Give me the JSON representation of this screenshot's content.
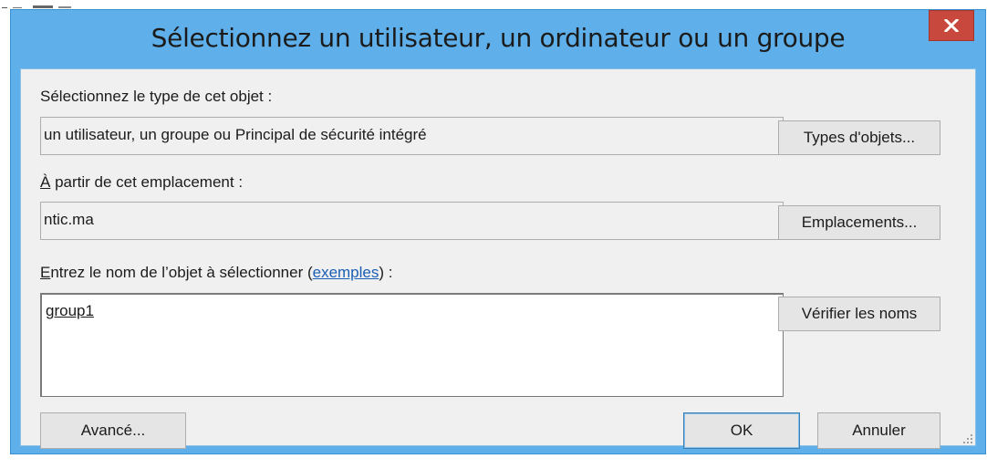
{
  "dialog": {
    "title": "Sélectionnez un utilisateur, un ordinateur ou un groupe",
    "close_icon": "close-icon"
  },
  "object_type": {
    "label": "Sélectionnez le type de cet objet :",
    "value": "un utilisateur, un groupe ou Principal de sécurité intégré",
    "button_label": "Types d'objets..."
  },
  "location": {
    "label_prefix": "À",
    "label_rest": " partir de cet emplacement :",
    "value": "ntic.ma",
    "button_label": "Emplacements..."
  },
  "object_name": {
    "label_accel": "E",
    "label_rest": "ntrez le nom de l’objet à sélectionner (",
    "link": "exemples",
    "label_end": ") :",
    "value": "group1",
    "check_button_label": "Vérifier les noms"
  },
  "footer": {
    "advanced_label": "Avancé...",
    "ok_label": "OK",
    "cancel_label": "Annuler"
  },
  "colors": {
    "frame": "#5fb0ea",
    "client_bg": "#f0f0f0",
    "close_button": "#c8483d",
    "link": "#1a5fb4"
  }
}
